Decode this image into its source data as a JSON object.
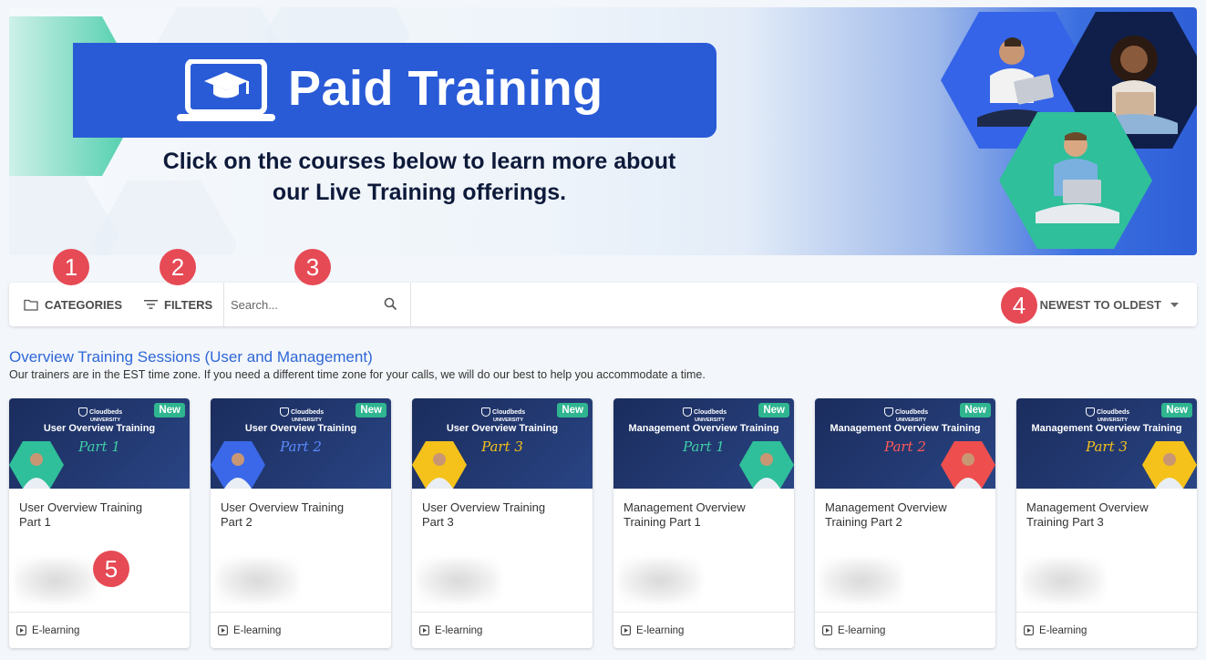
{
  "banner": {
    "title": "Paid Training",
    "subtitle_line1": "Click on the courses below to learn more about",
    "subtitle_line2": "our Live Training offerings."
  },
  "badges": [
    "1",
    "2",
    "3",
    "4",
    "5"
  ],
  "toolbar": {
    "categories_label": "CATEGORIES",
    "filters_label": "FILTERS",
    "search_placeholder": "Search...",
    "sort_label": "NEWEST TO OLDEST"
  },
  "section": {
    "title": "Overview Training Sessions (User and Management)",
    "description": "Our trainers are in the EST time zone. If you need a different time zone for your calls, we will do our best to help you accommodate a time."
  },
  "thumb_logo": {
    "brand": "Cloudbeds",
    "sub": "UNIVERSITY"
  },
  "cards": [
    {
      "thumb_title": "User Overview Training",
      "thumb_part": "Part 1",
      "part_color": "#3fd0a8",
      "hex_color": "#2fbf9a",
      "badge": "New",
      "title_line1": "User Overview Training",
      "title_line2": "Part 1",
      "type": "E-learning"
    },
    {
      "thumb_title": "User Overview Training",
      "thumb_part": "Part 2",
      "part_color": "#5b8cff",
      "hex_color": "#3a68e8",
      "badge": "New",
      "title_line1": "User Overview Training",
      "title_line2": "Part 2",
      "type": "E-learning"
    },
    {
      "thumb_title": "User Overview Training",
      "thumb_part": "Part 3",
      "part_color": "#f5c21b",
      "hex_color": "#f5c21b",
      "badge": "New",
      "title_line1": "User Overview Training",
      "title_line2": "Part 3",
      "type": "E-learning"
    },
    {
      "thumb_title": "Management Overview Training",
      "thumb_part": "Part 1",
      "part_color": "#3fd0a8",
      "hex_color": "#2fbf9a",
      "badge": "New",
      "title_line1": "Management Overview",
      "title_line2": "Training Part 1",
      "type": "E-learning"
    },
    {
      "thumb_title": "Management Overview Training",
      "thumb_part": "Part 2",
      "part_color": "#ff5a5a",
      "hex_color": "#ef4e4e",
      "badge": "New",
      "title_line1": "Management Overview",
      "title_line2": "Training Part 2",
      "type": "E-learning"
    },
    {
      "thumb_title": "Management Overview Training",
      "thumb_part": "Part 3",
      "part_color": "#f5c21b",
      "hex_color": "#f5c21b",
      "badge": "New",
      "title_line1": "Management Overview",
      "title_line2": "Training Part 3",
      "type": "E-learning"
    }
  ],
  "colors": {
    "accent": "#2a5bd7",
    "badge_red": "#e64a55",
    "new_green": "#2fb58f",
    "link_blue": "#2e67d8"
  }
}
